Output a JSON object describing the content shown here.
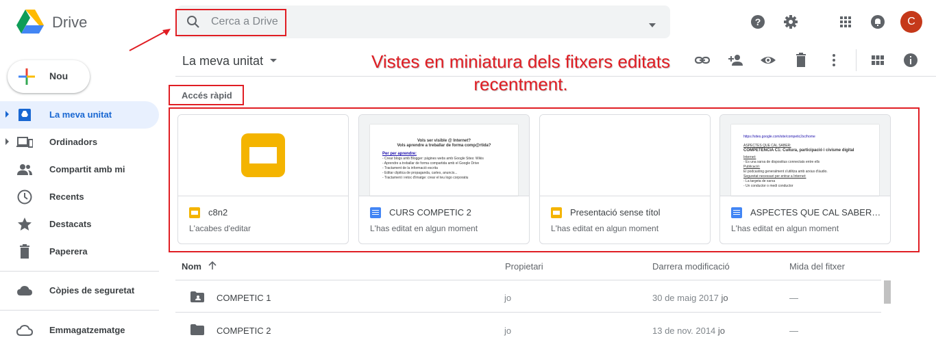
{
  "app": {
    "name": "Drive"
  },
  "search": {
    "placeholder": "Cerca a Drive"
  },
  "header": {
    "avatar_letter": "C"
  },
  "sidebar": {
    "new_label": "Nou",
    "items": [
      {
        "label": "La meva unitat",
        "icon": "my-drive-icon"
      },
      {
        "label": "Ordinadors",
        "icon": "computers-icon"
      },
      {
        "label": "Compartit amb mi",
        "icon": "shared-icon"
      },
      {
        "label": "Recents",
        "icon": "clock-icon"
      },
      {
        "label": "Destacats",
        "icon": "star-icon"
      },
      {
        "label": "Paperera",
        "icon": "trash-icon"
      },
      {
        "label": "Còpies de seguretat",
        "icon": "cloud-icon"
      },
      {
        "label": "Emmagatzematge",
        "icon": "cloud-outline-icon"
      }
    ]
  },
  "toolbar": {
    "title": "La meva unitat"
  },
  "annotation": {
    "line1": "Vistes en miniatura dels fitxers editats",
    "line2": "recentment."
  },
  "quick_access": {
    "label": "Accés ràpid",
    "cards": [
      {
        "title": "c8n2",
        "subtitle": "L'acabes d'editar",
        "type": "slides"
      },
      {
        "title": "CURS COMPETIC 2",
        "subtitle": "L'has editat en algun moment",
        "type": "docs"
      },
      {
        "title": "Presentació sense títol",
        "subtitle": "L'has editat en algun moment",
        "type": "slides"
      },
      {
        "title": "ASPECTES QUE CAL SABER P...",
        "subtitle": "L'has editat en algun moment",
        "type": "docs"
      }
    ]
  },
  "thumb2": {
    "l1": "Vols ser visible @ Internet?",
    "l2": "Vols aprendre a treballar de forma comp@rtida?",
    "l3": "Per per aprendre:",
    "l4": "- Crear blogs amb Blogger: pàgines webs amb Google Sites: Wikis",
    "l5": "- Aprendre a treballar de forma compartida amb el Google Drive",
    "l6": "- Tractament de la informació escrita",
    "l7": "- Editar clipitica de propaganda, cartes, anuncis...",
    "l8": "- Tractament i retoc d'imatge: crear el teu logo corporatiu"
  },
  "thumb4": {
    "l1": "https://sites.google.com/site/competic2sc/home",
    "l2": "ASPECTES QUE CAL SABER:",
    "l3": "COMPETÈNCIA C1: Cultura, participació i civisme digital",
    "l4": "Internet:",
    "l5": "- Es una xarxa de dispositius connectats entre ells",
    "l6": "Publicació:",
    "l7": "El podcasting generalment s'utilitza amb arxius d'àudio.",
    "l8": "Seguretat necessari per entrar a Internet:",
    "l9": "- La targeta de xarxa",
    "l10": "- Un conductor o medi conductor"
  },
  "list": {
    "columns": {
      "name": "Nom",
      "owner": "Propietari",
      "modified": "Darrera modificació",
      "size": "Mida del fitxer"
    },
    "rows": [
      {
        "name": "COMPETIC 1",
        "owner": "jo",
        "modified": "30 de maig 2017",
        "modified_by": "jo",
        "size": "—",
        "icon": "shared-folder-icon"
      },
      {
        "name": "COMPETIC 2",
        "owner": "jo",
        "modified": "13 de nov. 2014",
        "modified_by": "jo",
        "size": "—",
        "icon": "folder-icon"
      }
    ]
  },
  "colors": {
    "accent": "#1967d2",
    "annotation": "#e01d23",
    "avatar": "#c5391a",
    "slides": "#f4b400",
    "docs": "#4285f4"
  }
}
